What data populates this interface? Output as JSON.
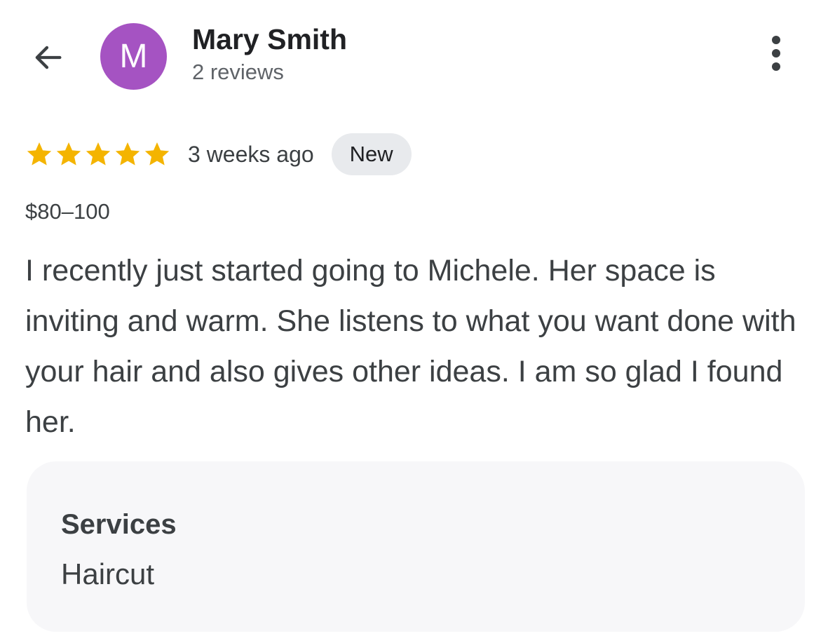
{
  "header": {
    "back_icon": "arrow-left-icon",
    "avatar_letter": "M",
    "avatar_color": "#a553c2",
    "reviewer_name": "Mary Smith",
    "review_count": "2 reviews",
    "menu_icon": "more-vert-icon"
  },
  "review": {
    "rating": 5,
    "rating_max": 5,
    "star_color": "#f4b400",
    "time_ago": "3 weeks ago",
    "badge": "New",
    "price_range": "$80–100",
    "text": "I recently just started going to Michele. Her space is inviting and warm. She listens to what you want done with your hair and also gives other ideas. I am so glad I found her."
  },
  "services": {
    "title": "Services",
    "value": "Haircut"
  }
}
